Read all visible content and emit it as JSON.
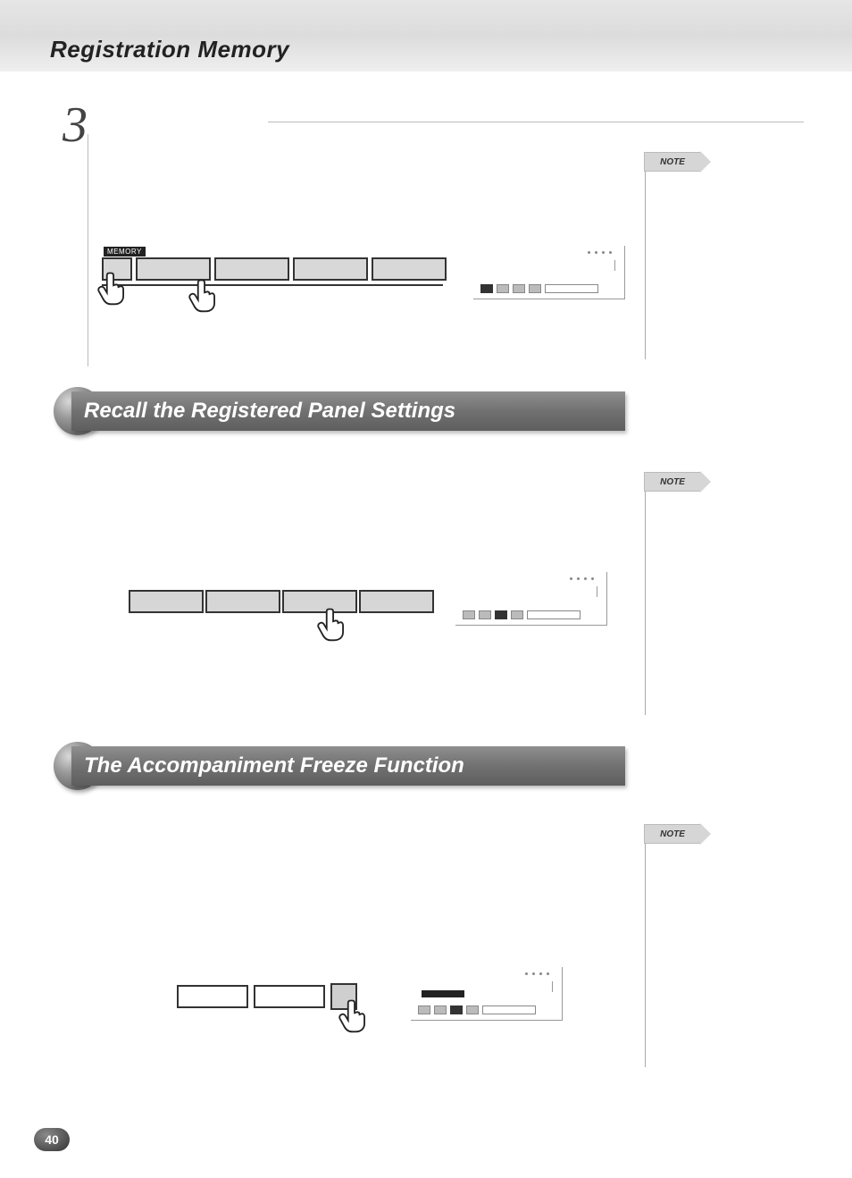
{
  "header": {
    "title": "Registration Memory"
  },
  "step": {
    "number": "3"
  },
  "notes": {
    "label": "NOTE"
  },
  "sections": {
    "recall": {
      "title": "Recall the Registered Panel Settings"
    },
    "freeze": {
      "title": "The Accompaniment Freeze Function"
    }
  },
  "diagram": {
    "memory_label": "MEMORY"
  },
  "page": {
    "number": "40"
  }
}
